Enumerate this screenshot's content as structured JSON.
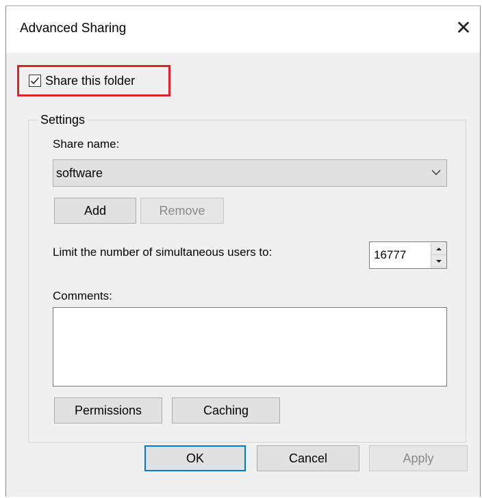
{
  "window": {
    "title": "Advanced Sharing",
    "close_icon": "close-icon"
  },
  "share_checkbox": {
    "label": "Share this folder",
    "checked": true,
    "highlight_color": "#e0202a"
  },
  "settings": {
    "legend": "Settings",
    "share_name_label": "Share name:",
    "share_name_value": "software",
    "add_label": "Add",
    "remove_label": "Remove",
    "limit_label": "Limit the number of simultaneous users to:",
    "limit_value": "16777",
    "comments_label": "Comments:",
    "comments_value": "",
    "permissions_label": "Permissions",
    "caching_label": "Caching"
  },
  "footer": {
    "ok_label": "OK",
    "cancel_label": "Cancel",
    "apply_label": "Apply"
  },
  "colors": {
    "dialog_bg": "#f0f0f0",
    "accent": "#0078d7"
  }
}
